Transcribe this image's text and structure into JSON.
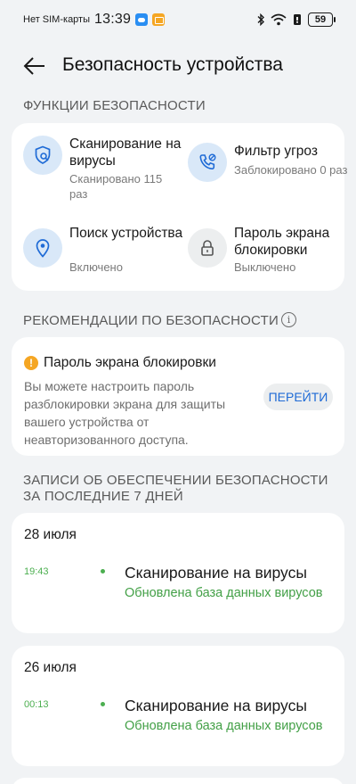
{
  "status_bar": {
    "carrier": "Нет SIM-карты",
    "time": "13:39",
    "battery": "59"
  },
  "header": {
    "title": "Безопасность устройства"
  },
  "features_section": {
    "label": "ФУНКЦИИ БЕЗОПАСНОСТИ",
    "items": [
      {
        "title": "Сканирование на вирусы",
        "subtitle": "Сканировано 115 раз",
        "icon": "virus-scan-shield-icon"
      },
      {
        "title": "Фильтр угроз",
        "subtitle": "Заблокировано 0 раз",
        "icon": "phone-block-icon"
      },
      {
        "title": "Поиск устройства",
        "subtitle": "Включено",
        "icon": "location-pin-icon"
      },
      {
        "title": "Пароль экрана блокировки",
        "subtitle": "Выключено",
        "icon": "lock-icon"
      }
    ]
  },
  "recommendations": {
    "label": "РЕКОМЕНДАЦИИ ПО БЕЗОПАСНОСТИ",
    "title": "Пароль экрана блокировки",
    "body": "Вы можете настроить пароль разблокировки экрана для защиты вашего устройства от неавторизованного доступа.",
    "button": "ПЕРЕЙТИ"
  },
  "records": {
    "label": "ЗАПИСИ ОБ ОБЕСПЕЧЕНИИ БЕЗОПАСНОСТИ ЗА ПОСЛЕДНИЕ 7 ДНЕЙ",
    "entries": [
      {
        "date": "28 июля",
        "time": "19:43",
        "title": "Сканирование на вирусы",
        "subtitle": "Обновлена база данных вирусов"
      },
      {
        "date": "26 июля",
        "time": "00:13",
        "title": "Сканирование на вирусы",
        "subtitle": "Обновлена база данных вирусов"
      }
    ]
  },
  "colors": {
    "accent_blue": "#1f6bd6",
    "success_green": "#43a047",
    "warning_orange": "#f5a623",
    "background": "#f1f3f5"
  }
}
